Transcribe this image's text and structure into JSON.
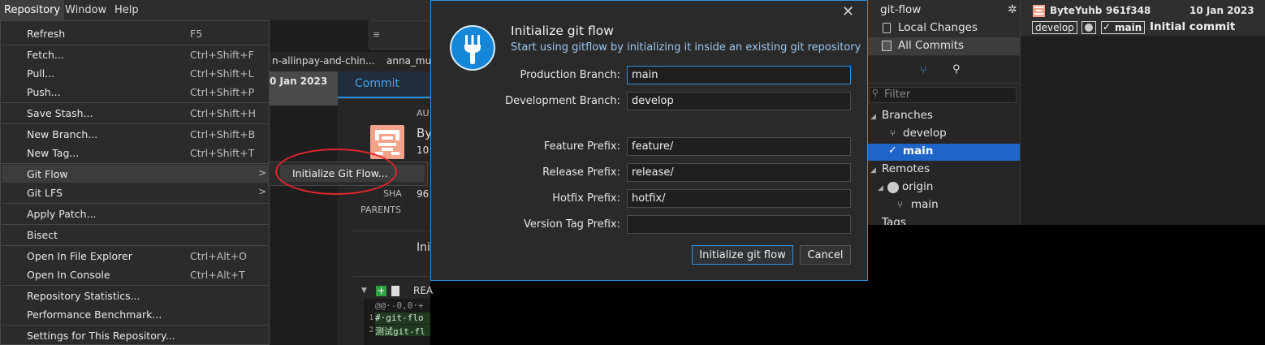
{
  "menubar": {
    "items": [
      "Repository",
      "Window",
      "Help"
    ]
  },
  "repo_menu": {
    "items": [
      {
        "label": "Refresh",
        "shortcut": "F5"
      },
      {
        "label": "Fetch...",
        "shortcut": "Ctrl+Shift+F"
      },
      {
        "label": "Pull...",
        "shortcut": "Ctrl+Shift+L"
      },
      {
        "label": "Push...",
        "shortcut": "Ctrl+Shift+P"
      },
      {
        "label": "Save Stash...",
        "shortcut": "Ctrl+Shift+H"
      },
      {
        "label": "New Branch...",
        "shortcut": "Ctrl+Shift+B"
      },
      {
        "label": "New Tag...",
        "shortcut": "Ctrl+Shift+T"
      },
      {
        "label": "Git Flow",
        "shortcut": ""
      },
      {
        "label": "Git LFS",
        "shortcut": ""
      },
      {
        "label": "Apply Patch...",
        "shortcut": ""
      },
      {
        "label": "Bisect",
        "shortcut": ""
      },
      {
        "label": "Open In File Explorer",
        "shortcut": "Ctrl+Alt+O"
      },
      {
        "label": "Open In Console",
        "shortcut": "Ctrl+Alt+T"
      },
      {
        "label": "Repository Statistics...",
        "shortcut": ""
      },
      {
        "label": "Performance Benchmark...",
        "shortcut": ""
      },
      {
        "label": "Settings for This Repository...",
        "shortcut": ""
      }
    ],
    "submenu_item": "Initialize Git Flow..."
  },
  "background": {
    "repo_tabs": [
      "n-allinpay-and-chin...",
      "anna_mus"
    ],
    "commit_date_partial": "0 Jan 2023",
    "commit_tab": "Commit",
    "author_label_partial": "AU",
    "author_partial": "By",
    "date_partial": "10",
    "sha_label": "SHA",
    "sha_partial": "96",
    "parents_label": "PARENTS",
    "message_partial": "Ini",
    "file_partial": "REA",
    "diff_lines": [
      "@@·-0,0·+",
      "#·git-flo",
      "测试git-fl"
    ],
    "line_numbers": [
      "1",
      "2"
    ]
  },
  "dialog": {
    "title": "Initialize git flow",
    "subtitle": "Start using gitflow by initializing it inside an existing git repository",
    "fields": [
      {
        "label": "Production Branch:",
        "value": "main"
      },
      {
        "label": "Development Branch:",
        "value": "develop"
      },
      {
        "label": "Feature Prefix:",
        "value": "feature/"
      },
      {
        "label": "Release Prefix:",
        "value": "release/"
      },
      {
        "label": "Hotfix Prefix:",
        "value": "hotfix/"
      },
      {
        "label": "Version Tag Prefix:",
        "value": ""
      }
    ],
    "init_button": "Initialize git flow",
    "cancel_button": "Cancel",
    "close_glyph": "✕"
  },
  "sidebar": {
    "repo_name": "git-flow",
    "views": [
      "Local Changes",
      "All Commits"
    ],
    "filter_placeholder": "Filter",
    "branches_header": "Branches",
    "branches": [
      "develop",
      "main"
    ],
    "remotes_header": "Remotes",
    "remote": "origin",
    "remote_branches": [
      "main"
    ],
    "tags_header": "Tags"
  },
  "commits": {
    "author": "ByteYuhb",
    "sha": "961f348",
    "date": "10 Jan 2023",
    "badges": [
      "develop",
      "main"
    ],
    "message": "Initial commit"
  },
  "colors": {
    "accent": "#2f8fe0",
    "highlight": "#1f64c7",
    "annotation": "#e0252d"
  }
}
